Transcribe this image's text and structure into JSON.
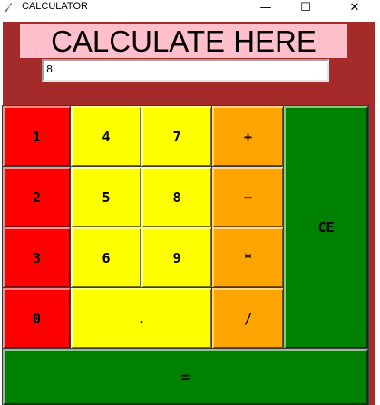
{
  "window": {
    "title": "CALCULATOR",
    "minimize_glyph": "—",
    "maximize_glyph": "☐",
    "close_glyph": "✕",
    "icon": "feather-icon"
  },
  "heading": "CALCULATE HERE",
  "display_value": "8",
  "keys": {
    "k1": "1",
    "k2": "2",
    "k3": "3",
    "k0": "0",
    "k4": "4",
    "k5": "5",
    "k6": "6",
    "dot": ".",
    "k7": "7",
    "k8": "8",
    "k9": "9",
    "plus": "+",
    "minus": "−",
    "multiply": "*",
    "divide": "/",
    "clear": "CE",
    "equals": "="
  },
  "colors": {
    "background": "#a52a2a",
    "heading_bg": "#ffc0cb",
    "number_col1": "#ff0000",
    "number_keys": "#ffff00",
    "operator_keys": "#ffa500",
    "action_keys": "#008000"
  }
}
